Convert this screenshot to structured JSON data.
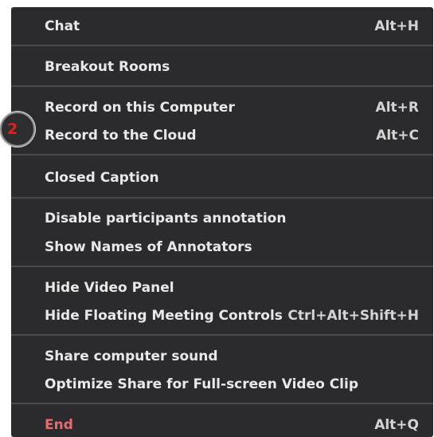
{
  "menu": {
    "items": [
      {
        "label": "Chat",
        "shortcut": "Alt+H"
      },
      {
        "label": "Breakout Rooms",
        "shortcut": ""
      },
      {
        "label": "Record on this Computer",
        "shortcut": "Alt+R"
      },
      {
        "label": "Record to the Cloud",
        "shortcut": "Alt+C"
      },
      {
        "label": "Closed Caption",
        "shortcut": ""
      },
      {
        "label": "Disable participants annotation",
        "shortcut": ""
      },
      {
        "label": "Show Names of Annotators",
        "shortcut": ""
      },
      {
        "label": "Hide Video Panel",
        "shortcut": ""
      },
      {
        "label": "Hide Floating Meeting Controls",
        "shortcut": "Ctrl+Alt+Shift+H"
      },
      {
        "label": "Share computer sound",
        "shortcut": ""
      },
      {
        "label": "Optimize Share for Full-screen Video Clip",
        "shortcut": ""
      },
      {
        "label": "End",
        "shortcut": "Alt+Q"
      }
    ]
  },
  "badge": {
    "number": "2"
  },
  "colors": {
    "menu_background": "#2b2b2d",
    "text": "#e8e8e8",
    "end_text": "#e96a6e",
    "badge_number": "#e02020"
  }
}
